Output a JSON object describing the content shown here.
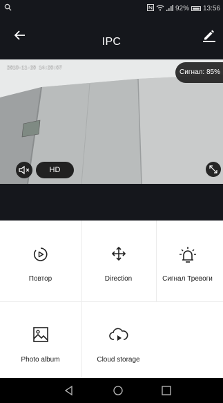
{
  "status_bar": {
    "battery_percent": "92%",
    "time": "13:56",
    "icons": [
      "search-icon",
      "nfc-icon",
      "wifi-icon",
      "signal-icon",
      "battery-icon"
    ]
  },
  "app_bar": {
    "title": "IPC",
    "icons": [
      "back-arrow-icon",
      "edit-pencil-icon"
    ]
  },
  "video": {
    "timestamp": "2018-11-28 14:28:07",
    "signal_label": "Сигнал: 85%",
    "hd_label": "HD",
    "icons": [
      "mute-icon",
      "fullscreen-icon"
    ]
  },
  "functions": [
    {
      "label": "Повтор",
      "icon": "replay-icon"
    },
    {
      "label": "Direction",
      "icon": "direction-arrows-icon"
    },
    {
      "label": "Сигнал Тревоги",
      "icon": "alarm-icon"
    },
    {
      "label": "Photo album",
      "icon": "photo-album-icon"
    },
    {
      "label": "Cloud storage",
      "icon": "cloud-storage-icon"
    }
  ],
  "nav_bar": {
    "icons": [
      "nav-back-icon",
      "nav-home-icon",
      "nav-recents-icon"
    ]
  },
  "colors": {
    "dark_header": "#15171c",
    "icon_color": "#222222",
    "divider": "#ececec"
  }
}
